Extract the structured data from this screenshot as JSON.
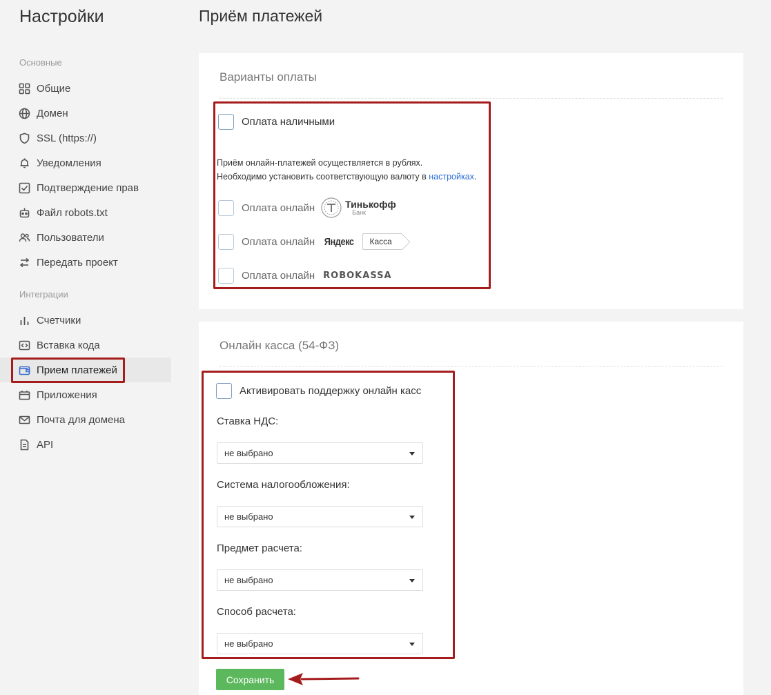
{
  "sidebar": {
    "title": "Настройки",
    "section_main": "Основные",
    "section_integrations": "Интеграции",
    "items_main": [
      {
        "label": "Общие",
        "icon": "grid-icon"
      },
      {
        "label": "Домен",
        "icon": "globe-icon"
      },
      {
        "label": "SSL (https://)",
        "icon": "shield-icon"
      },
      {
        "label": "Уведомления",
        "icon": "bell-icon"
      },
      {
        "label": "Подтверждение прав",
        "icon": "checkbox-icon"
      },
      {
        "label": "Файл robots.txt",
        "icon": "robot-icon"
      },
      {
        "label": "Пользователи",
        "icon": "users-icon"
      },
      {
        "label": "Передать проект",
        "icon": "transfer-icon"
      }
    ],
    "items_integrations": [
      {
        "label": "Счетчики",
        "icon": "bar-chart-icon"
      },
      {
        "label": "Вставка кода",
        "icon": "code-icon"
      },
      {
        "label": "Прием платежей",
        "icon": "wallet-icon"
      },
      {
        "label": "Приложения",
        "icon": "apps-icon"
      },
      {
        "label": "Почта для домена",
        "icon": "mail-icon"
      },
      {
        "label": "API",
        "icon": "document-icon"
      }
    ]
  },
  "main": {
    "title": "Приём платежей",
    "payment_options": {
      "title": "Варианты оплаты",
      "cash_label": "Оплата наличными",
      "info_line1": "Приём онлайн-платежей осуществляется в рублях.",
      "info_line2_prefix": "Необходимо установить соответствующую валюту в ",
      "info_link": "настройках",
      "info_line2_suffix": ".",
      "online_label": "Оплата онлайн",
      "tinkoff_name": "Тинькофф",
      "tinkoff_sub": "Банк",
      "yandex_name": "Яндекс",
      "yandex_tag": "Касса",
      "robokassa_name": "ROBOKASSA"
    },
    "online_kassa": {
      "title": "Онлайн касса (54-ФЗ)",
      "activate_label": "Активировать поддержку онлайн касс",
      "fields": [
        {
          "label": "Ставка НДС:",
          "value": "не выбрано"
        },
        {
          "label": "Система налогообложения:",
          "value": "не выбрано"
        },
        {
          "label": "Предмет расчета:",
          "value": "не выбрано"
        },
        {
          "label": "Способ расчета:",
          "value": "не выбрано"
        }
      ],
      "save_label": "Сохранить"
    }
  },
  "colors": {
    "highlight": "#a51c1c",
    "save_button": "#5cb85c",
    "link": "#2d6fd6"
  }
}
